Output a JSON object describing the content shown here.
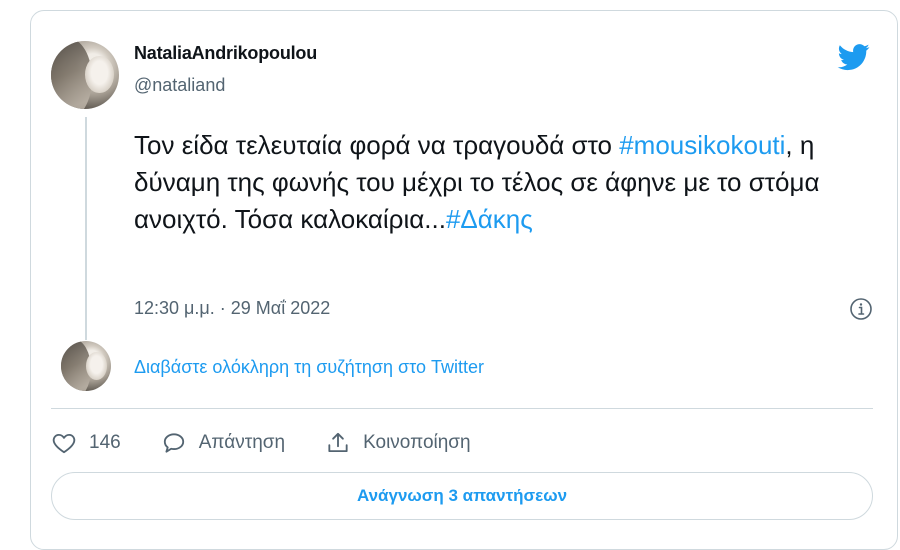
{
  "tweet": {
    "author_name": "NataliaAndrikopoulou",
    "author_handle": "@nataliand",
    "text_part1": "Τον είδα τελευταία φορά να τραγουδά στο ",
    "hashtag1": "#mousikokouti",
    "text_part2": ", η δύναμη της φωνής του μέχρι το τέλος σε άφηνε με το στόμα ανοιχτό. Τόσα καλοκαίρια...",
    "hashtag2": "#Δάκης",
    "timestamp": "12:30 μ.μ. · 29 Μαΐ 2022",
    "read_thread_label": "Διαβάστε ολόκληρη τη συζήτηση στο Twitter",
    "like_count": "146",
    "reply_label": "Απάντηση",
    "share_label": "Κοινοποίηση",
    "read_replies_label": "Ανάγνωση 3 απαντήσεων"
  },
  "icons": {
    "logo": "twitter-bird-icon",
    "info": "info-circle-icon",
    "like": "heart-icon",
    "reply": "speech-bubble-icon",
    "share": "share-upload-icon"
  },
  "colors": {
    "accent": "#1d9bf0",
    "text": "#0f1419",
    "muted": "#536471",
    "border": "#cfd9de"
  }
}
